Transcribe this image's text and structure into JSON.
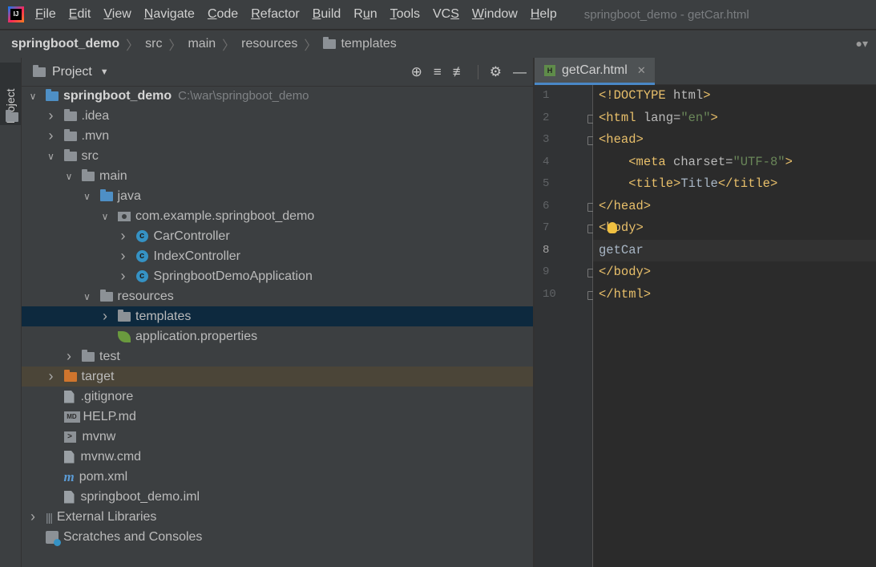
{
  "menu": {
    "items": [
      {
        "u": "F",
        "rest": "ile"
      },
      {
        "u": "E",
        "rest": "dit"
      },
      {
        "u": "V",
        "rest": "iew"
      },
      {
        "u": "N",
        "rest": "avigate"
      },
      {
        "u": "C",
        "rest": "ode"
      },
      {
        "u": "R",
        "rest": "efactor"
      },
      {
        "u": "B",
        "rest": "uild"
      },
      {
        "pre": "R",
        "u": "u",
        "rest": "n"
      },
      {
        "u": "T",
        "rest": "ools"
      },
      {
        "pre": "VC",
        "u": "S",
        "rest": ""
      },
      {
        "u": "W",
        "rest": "indow"
      },
      {
        "u": "H",
        "rest": "elp"
      }
    ],
    "window_title": "springboot_demo - getCar.html"
  },
  "breadcrumb": [
    "springboot_demo",
    "src",
    "main",
    "resources",
    "templates"
  ],
  "left_strip": {
    "label": "Project"
  },
  "project_panel": {
    "title": "Project",
    "tree": [
      {
        "label": "springboot_demo",
        "path": "C:\\war\\springboot_demo",
        "depth": 0,
        "arrow": "open",
        "icon": "module-folder",
        "bold": true
      },
      {
        "label": ".idea",
        "depth": 1,
        "arrow": "closed",
        "icon": "folder"
      },
      {
        "label": ".mvn",
        "depth": 1,
        "arrow": "closed",
        "icon": "folder"
      },
      {
        "label": "src",
        "depth": 1,
        "arrow": "open",
        "icon": "folder"
      },
      {
        "label": "main",
        "depth": 2,
        "arrow": "open",
        "icon": "folder"
      },
      {
        "label": "java",
        "depth": 3,
        "arrow": "open",
        "icon": "folder-blue"
      },
      {
        "label": "com.example.springboot_demo",
        "depth": 4,
        "arrow": "open",
        "icon": "package"
      },
      {
        "label": "CarController",
        "depth": 5,
        "arrow": "closed",
        "icon": "class"
      },
      {
        "label": "IndexController",
        "depth": 5,
        "arrow": "closed",
        "icon": "class"
      },
      {
        "label": "SpringbootDemoApplication",
        "depth": 5,
        "arrow": "closed",
        "icon": "class"
      },
      {
        "label": "resources",
        "depth": 3,
        "arrow": "open",
        "icon": "folder-resources"
      },
      {
        "label": "templates",
        "depth": 4,
        "arrow": "closed",
        "icon": "folder",
        "selected": true
      },
      {
        "label": "application.properties",
        "depth": 4,
        "arrow": "none",
        "icon": "spring-leaf"
      },
      {
        "label": "test",
        "depth": 2,
        "arrow": "closed",
        "icon": "folder"
      },
      {
        "label": "target",
        "depth": 1,
        "arrow": "closed",
        "icon": "folder-orange",
        "highlight": true
      },
      {
        "label": ".gitignore",
        "depth": 1,
        "arrow": "none",
        "icon": "file"
      },
      {
        "label": "HELP.md",
        "depth": 1,
        "arrow": "none",
        "icon": "markdown"
      },
      {
        "label": "mvnw",
        "depth": 1,
        "arrow": "none",
        "icon": "terminal"
      },
      {
        "label": "mvnw.cmd",
        "depth": 1,
        "arrow": "none",
        "icon": "file"
      },
      {
        "label": "pom.xml",
        "depth": 1,
        "arrow": "none",
        "icon": "maven"
      },
      {
        "label": "springboot_demo.iml",
        "depth": 1,
        "arrow": "none",
        "icon": "file"
      },
      {
        "label": "External Libraries",
        "depth": 0,
        "arrow": "closed",
        "icon": "libraries"
      },
      {
        "label": "Scratches and Consoles",
        "depth": 0,
        "arrow": "none",
        "icon": "scratches"
      }
    ]
  },
  "editor": {
    "tab_label": "getCar.html",
    "current_line": 8,
    "lines": [
      {
        "num": "1",
        "tokens": [
          {
            "c": "tag",
            "t": "<!DOCTYPE "
          },
          {
            "c": "attr",
            "t": "html"
          },
          {
            "c": "tag",
            "t": ">"
          }
        ]
      },
      {
        "num": "2",
        "fold": true,
        "tokens": [
          {
            "c": "tag",
            "t": "<html "
          },
          {
            "c": "attr",
            "t": "lang="
          },
          {
            "c": "str",
            "t": "\"en\""
          },
          {
            "c": "tag",
            "t": ">"
          }
        ]
      },
      {
        "num": "3",
        "fold": true,
        "tokens": [
          {
            "c": "tag",
            "t": "<head>"
          }
        ]
      },
      {
        "num": "4",
        "tokens": [
          {
            "c": "txt",
            "t": "    "
          },
          {
            "c": "tag",
            "t": "<meta "
          },
          {
            "c": "attr",
            "t": "charset="
          },
          {
            "c": "str",
            "t": "\"UTF-8\""
          },
          {
            "c": "tag",
            "t": ">"
          }
        ]
      },
      {
        "num": "5",
        "tokens": [
          {
            "c": "txt",
            "t": "    "
          },
          {
            "c": "tag",
            "t": "<title>"
          },
          {
            "c": "txt",
            "t": "Title"
          },
          {
            "c": "tag",
            "t": "</title>"
          }
        ]
      },
      {
        "num": "6",
        "fold": true,
        "tokens": [
          {
            "c": "tag",
            "t": "</head>"
          }
        ]
      },
      {
        "num": "7",
        "fold": true,
        "bulb": true,
        "tokens": [
          {
            "c": "tag",
            "t": "<body>"
          }
        ]
      },
      {
        "num": "8",
        "tokens": [
          {
            "c": "txt",
            "t": "getCar"
          }
        ]
      },
      {
        "num": "9",
        "fold": true,
        "tokens": [
          {
            "c": "tag",
            "t": "</body>"
          }
        ]
      },
      {
        "num": "10",
        "fold": true,
        "tokens": [
          {
            "c": "tag",
            "t": "</html>"
          }
        ]
      }
    ]
  }
}
